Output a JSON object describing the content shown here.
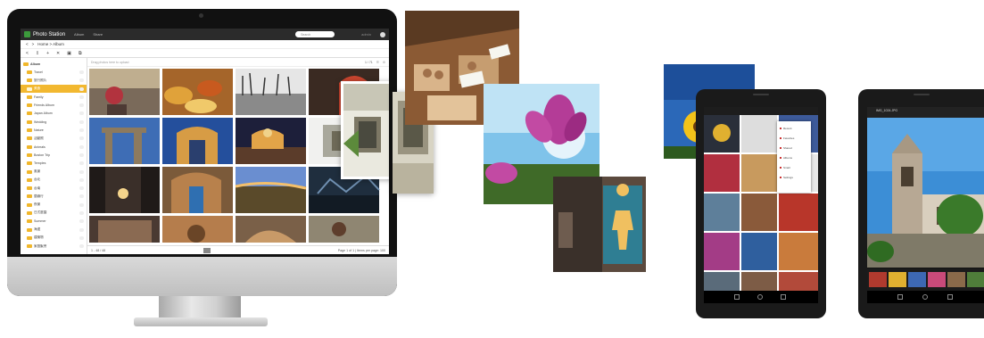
{
  "desktop_app": {
    "brand": "Photo Station",
    "nav": [
      "Album",
      "Share"
    ],
    "search_placeholder": "Search",
    "user_label": "admin",
    "breadcrumb": [
      "<",
      ">",
      "Home > Album"
    ],
    "toolbar_icons": [
      "share-icon",
      "upload-icon",
      "add-icon",
      "close-icon",
      "copy-icon",
      "more-icon"
    ],
    "sidebar": [
      {
        "label": "Album",
        "level": 0
      },
      {
        "label": "Travel",
        "level": 1
      },
      {
        "label": "旅行照片",
        "level": 1
      },
      {
        "label": "美食",
        "level": 1,
        "active": true
      },
      {
        "label": "Family",
        "level": 1
      },
      {
        "label": "Friends Album",
        "level": 1
      },
      {
        "label": "Japan Album",
        "level": 1
      },
      {
        "label": "Wedding",
        "level": 1
      },
      {
        "label": "Nature",
        "level": 1
      },
      {
        "label": "活動照",
        "level": 1
      },
      {
        "label": "Animals",
        "level": 1
      },
      {
        "label": "Boston Trip",
        "level": 1
      },
      {
        "label": "Temples",
        "level": 1
      },
      {
        "label": "風景",
        "level": 1
      },
      {
        "label": "台北",
        "level": 1
      },
      {
        "label": "台南",
        "level": 1
      },
      {
        "label": "蘭嶼行",
        "level": 1
      },
      {
        "label": "夜景",
        "level": 1
      },
      {
        "label": "日式庭園",
        "level": 1
      },
      {
        "label": "Summer",
        "level": 1
      },
      {
        "label": "海邊",
        "level": 1
      },
      {
        "label": "建築物",
        "level": 1
      },
      {
        "label": "家庭聚會",
        "level": 1
      }
    ],
    "main_bar": {
      "hint": "Drag photos here to upload",
      "count": "1 / 71"
    },
    "footer": {
      "left": "1 - 48 / 48",
      "right": "Page 1 of 1 | Items per page: 100"
    }
  },
  "tablet_right": {
    "title": "IMG_1024.JPG"
  },
  "tablet_left": {
    "menu": [
      "Recent",
      "Favorites",
      "Shared",
      "Albums",
      "Smart",
      "Settings"
    ]
  },
  "colors": {
    "monitor_bezel": "#111111",
    "sidebar_highlight": "#f2b830",
    "folder": "#f1b72a",
    "app_header": "#2b2b2b"
  }
}
